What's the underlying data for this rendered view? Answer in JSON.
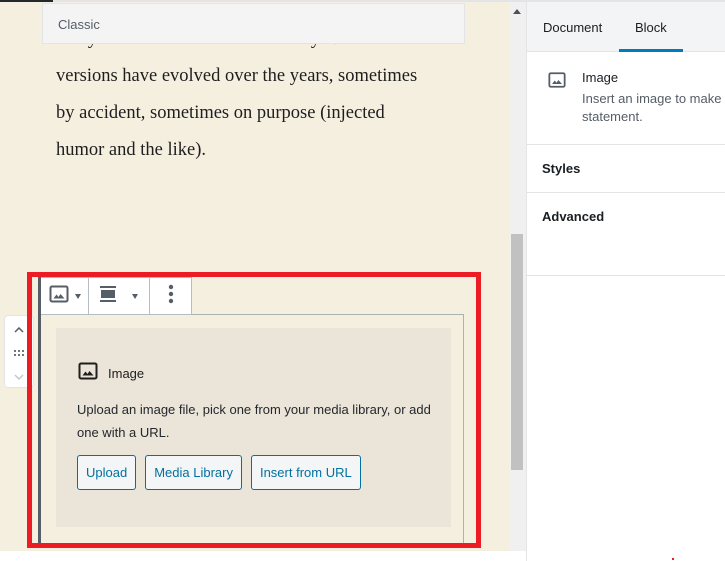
{
  "editor": {
    "classic_bar_label": "Classic",
    "paragraph_lines": [
      "many web sites still in their infancy. Various",
      "versions have evolved over the years, sometimes",
      "by accident, sometimes on purpose (injected",
      "humor and the like)."
    ]
  },
  "block": {
    "toolbar": {
      "items": [
        {
          "name": "change-block-type",
          "icon": "image-icon",
          "has_dropdown": true
        },
        {
          "name": "change-alignment",
          "icon": "align-wide-icon",
          "has_dropdown": true
        },
        {
          "name": "more-options",
          "icon": "vertical-ellipsis-icon",
          "has_dropdown": false
        }
      ]
    },
    "mover": {
      "up_icon": "chevron-up-icon",
      "drag_icon": "drag-handle-icon",
      "down_icon": "chevron-down-icon",
      "down_disabled": true
    },
    "placeholder": {
      "icon": "image-icon",
      "label": "Image",
      "instructions_lines": [
        "Upload an image file, pick one from your media library, or add",
        "one with a URL."
      ],
      "buttons": [
        "Upload",
        "Media Library",
        "Insert from URL"
      ]
    },
    "highlighted": true
  },
  "sidebar": {
    "tabs": [
      {
        "label": "Document",
        "active": false
      },
      {
        "label": "Block",
        "active": true
      }
    ],
    "block_card": {
      "icon": "image-icon",
      "title": "Image",
      "description_lines": [
        "Insert an image to make",
        "statement."
      ]
    },
    "panels": [
      {
        "label": "Styles"
      },
      {
        "label": "Advanced"
      }
    ]
  },
  "colors": {
    "editor_background": "#f5efe0",
    "placeholder_background": "#ebe4d8",
    "accent": "#0071a1",
    "tab_indicator": "#007cba",
    "highlight_frame": "#ed1c24"
  }
}
